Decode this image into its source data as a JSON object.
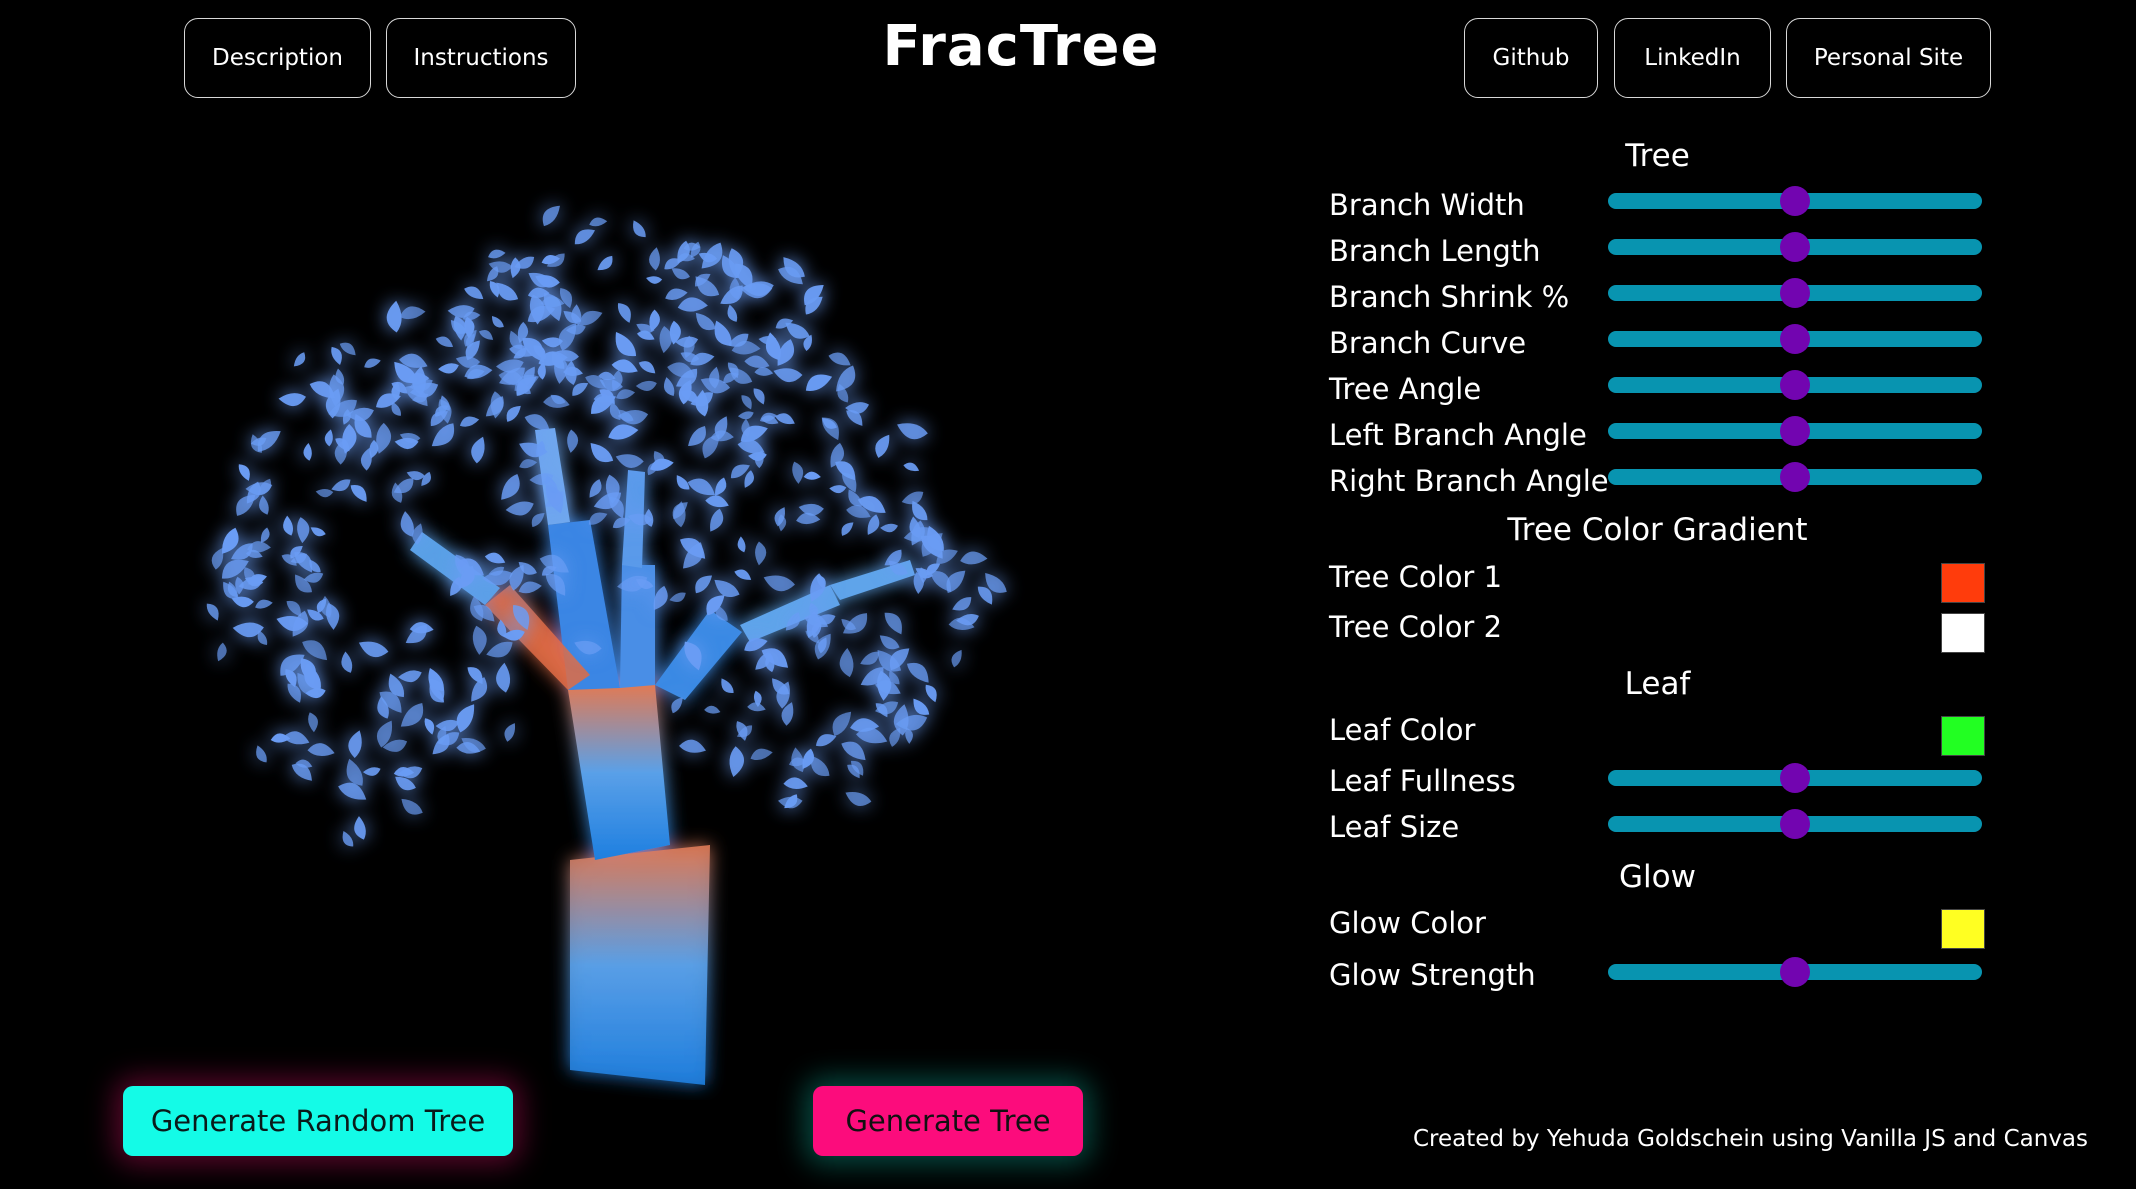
{
  "header": {
    "title": "FracTree",
    "left_buttons": [
      "Description",
      "Instructions"
    ],
    "right_buttons": [
      "Github",
      "LinkedIn",
      "Personal Site"
    ]
  },
  "controls": {
    "tree_section": "Tree",
    "branch_width": {
      "label": "Branch Width",
      "value": 0.5
    },
    "branch_length": {
      "label": "Branch Length",
      "value": 0.5
    },
    "branch_shrink": {
      "label": "Branch Shrink %",
      "value": 0.5
    },
    "branch_curve": {
      "label": "Branch Curve",
      "value": 0.5
    },
    "tree_angle": {
      "label": "Tree Angle",
      "value": 0.5
    },
    "left_branch_angle": {
      "label": "Left Branch Angle",
      "value": 0.5
    },
    "right_branch_angle": {
      "label": "Right Branch Angle",
      "value": 0.5
    },
    "gradient_section": "Tree Color Gradient",
    "tree_color_1": {
      "label": "Tree Color 1",
      "color": "#ff3c0c"
    },
    "tree_color_2": {
      "label": "Tree Color 2",
      "color": "#ffffff"
    },
    "leaf_section": "Leaf",
    "leaf_color": {
      "label": "Leaf Color",
      "color": "#22ff22"
    },
    "leaf_fullness": {
      "label": "Leaf Fullness",
      "value": 0.5
    },
    "leaf_size": {
      "label": "Leaf Size",
      "value": 0.5
    },
    "glow_section": "Glow",
    "glow_color": {
      "label": "Glow Color",
      "color": "#ffff22"
    },
    "glow_strength": {
      "label": "Glow Strength",
      "value": 0.5
    }
  },
  "actions": {
    "random_label": "Generate Random Tree",
    "generate_label": "Generate Tree"
  },
  "footer": "Created by Yehuda Goldschein using Vanilla JS and Canvas",
  "colors": {
    "slider_track": "#0894b0",
    "slider_thumb": "#7205b0",
    "random_button": "#14fbe7",
    "generate_button": "#fc0c7c",
    "trunk": "#2f8fe6",
    "leaf": "#6a9cf4"
  }
}
